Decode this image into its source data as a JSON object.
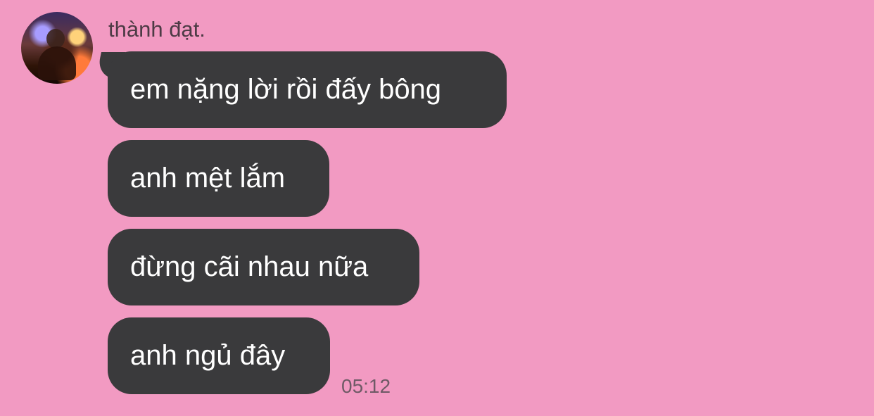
{
  "conversation": {
    "sender_name": "thành đạt.",
    "messages": [
      {
        "text": "em nặng lời rồi đấy bông"
      },
      {
        "text": "anh mệt lắm"
      },
      {
        "text": "đừng cãi nhau nữa"
      },
      {
        "text": "anh ngủ đây"
      }
    ],
    "timestamp": "05:12"
  },
  "theme": {
    "background": "#f29ac2",
    "bubble": "#3a3a3c",
    "bubble_text": "#ffffff"
  }
}
